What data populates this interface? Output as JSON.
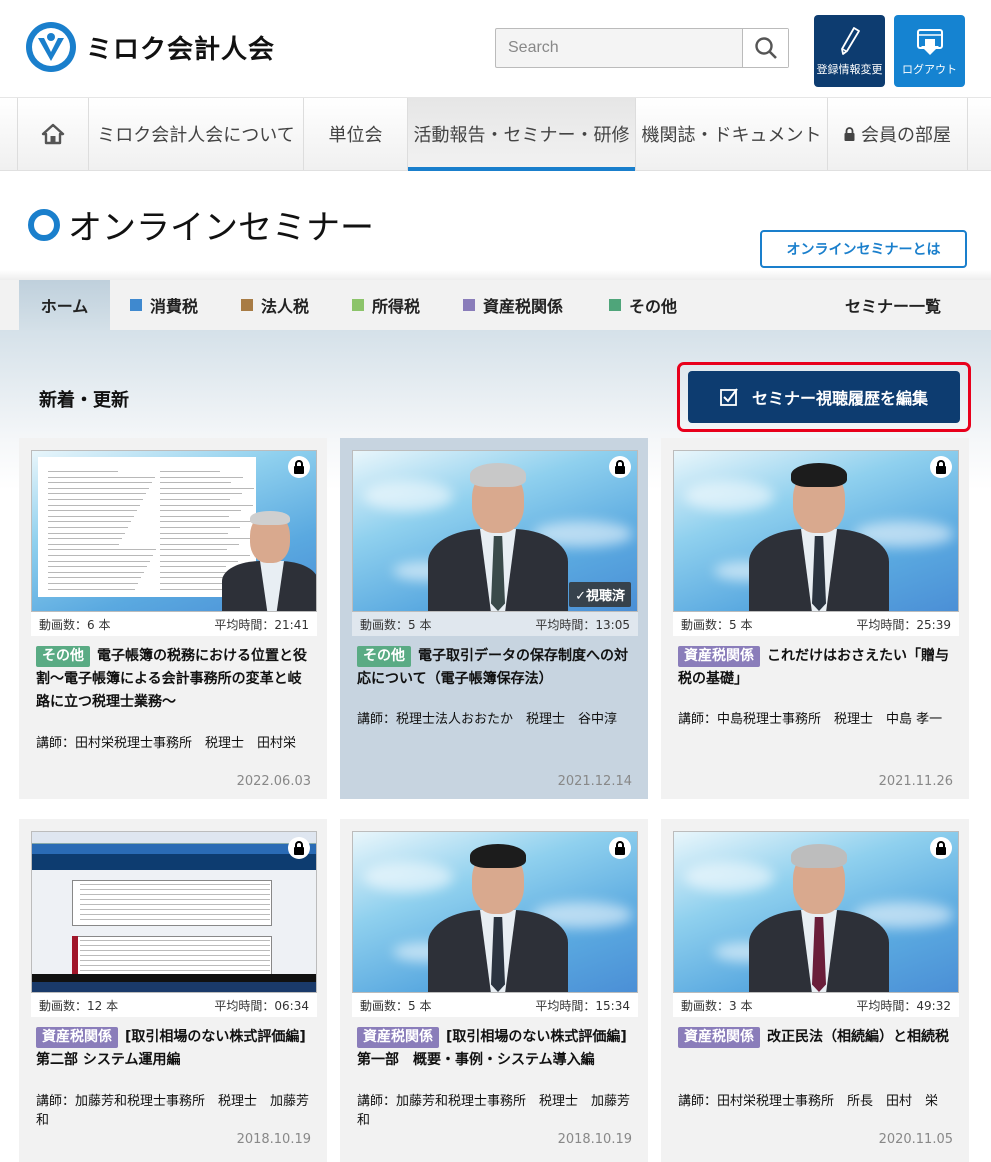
{
  "header": {
    "logo_text": "ミロク会計人会",
    "search_placeholder": "Search",
    "edit_profile_label": "登録情報変更",
    "logout_label": "ログアウト"
  },
  "global_nav": {
    "home_icon": "home-icon",
    "items": [
      {
        "label": "ミロク会計人会について",
        "active": false
      },
      {
        "label": "単位会",
        "active": false
      },
      {
        "label": "活動報告・セミナー・研修",
        "active": true
      },
      {
        "label": "機関誌・ドキュメント",
        "active": false
      },
      {
        "label": "会員の部屋",
        "active": false,
        "icon": "lock-icon"
      }
    ]
  },
  "page": {
    "title": "オンラインセミナー",
    "about_button": "オンラインセミナーとは"
  },
  "sub_nav": {
    "home": "ホーム",
    "categories": [
      {
        "label": "消費税",
        "color": "#3f89cf"
      },
      {
        "label": "法人税",
        "color": "#a87c45"
      },
      {
        "label": "所得税",
        "color": "#8cc46a"
      },
      {
        "label": "資産税関係",
        "color": "#8a7dba"
      },
      {
        "label": "その他",
        "color": "#4fa57a"
      }
    ],
    "list_link": "セミナー一覧"
  },
  "section": {
    "title": "新着・更新",
    "history_button": "セミナー視聴履歴を編集"
  },
  "colors": {
    "brand_blue": "#1a7fcc",
    "navy": "#0d3c70",
    "highlight_red": "#e8001c",
    "tag_other": "#5aab84",
    "tag_asset": "#8a7dba"
  },
  "cards": [
    {
      "videos": "動画数：6 本",
      "avg_time": "平均時間：21:41",
      "tag": "その他",
      "tag_color": "#5aab84",
      "title": "電子帳簿の税務における位置と役割〜電子帳簿による会計事務所の変革と岐路に立つ税理士業務〜",
      "lecturer": "講師：田村栄税理士事務所　税理士　田村栄",
      "date": "2022.06.03",
      "locked": true,
      "viewed": false,
      "thumb": "document-with-presenter"
    },
    {
      "videos": "動画数：5 本",
      "avg_time": "平均時間：13:05",
      "tag": "その他",
      "tag_color": "#5aab84",
      "title": "電子取引データの保存制度への対応について（電子帳簿保存法）",
      "lecturer": "講師：税理士法人おおたか　税理士　谷中淳",
      "date": "2021.12.14",
      "locked": true,
      "viewed": true,
      "viewed_label": "✓視聴済",
      "thumb": "presenter"
    },
    {
      "videos": "動画数：5 本",
      "avg_time": "平均時間：25:39",
      "tag": "資産税関係",
      "tag_color": "#8a7dba",
      "title": "これだけはおさえたい「贈与税の基礎」",
      "lecturer": "講師：中島税理士事務所　税理士　中島 孝一",
      "date": "2021.11.26",
      "locked": true,
      "viewed": false,
      "thumb": "presenter"
    },
    {
      "videos": "動画数：12 本",
      "avg_time": "平均時間：06:34",
      "tag": "資産税関係",
      "tag_color": "#8a7dba",
      "title": "[取引相場のない株式評価編] 第二部 システム運用編",
      "lecturer": "講師：加藤芳和税理士事務所　税理士　加藤芳和",
      "date": "2018.10.19",
      "locked": true,
      "viewed": false,
      "thumb": "software-screen"
    },
    {
      "videos": "動画数：5 本",
      "avg_time": "平均時間：15:34",
      "tag": "資産税関係",
      "tag_color": "#8a7dba",
      "title": "[取引相場のない株式評価編] 第一部　概要・事例・システム導入編",
      "lecturer": "講師：加藤芳和税理士事務所　税理士　加藤芳和",
      "date": "2018.10.19",
      "locked": true,
      "viewed": false,
      "thumb": "presenter"
    },
    {
      "videos": "動画数：3 本",
      "avg_time": "平均時間：49:32",
      "tag": "資産税関係",
      "tag_color": "#8a7dba",
      "title": "改正民法（相続編）と相続税",
      "lecturer": "講師：田村栄税理士事務所　所長　田村　栄",
      "date": "2020.11.05",
      "locked": true,
      "viewed": false,
      "thumb": "presenter"
    }
  ]
}
